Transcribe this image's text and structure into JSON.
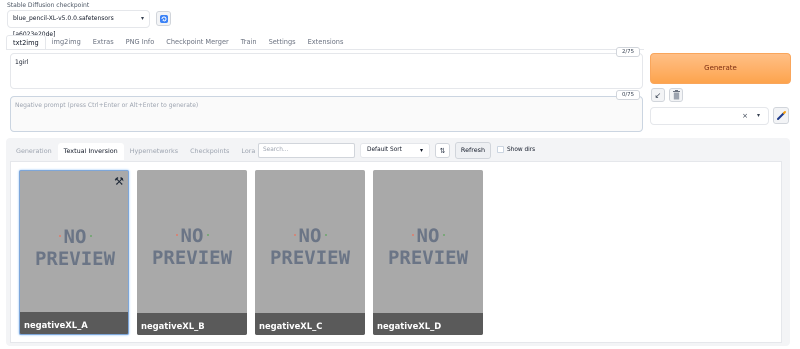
{
  "checkpoint": {
    "label": "Stable Diffusion checkpoint",
    "selected": "blue_pencil-XL-v5.0.0.safetensors [a6023e20de]"
  },
  "tabs": [
    "txt2img",
    "img2img",
    "Extras",
    "PNG Info",
    "Checkpoint Merger",
    "Train",
    "Settings",
    "Extensions"
  ],
  "prompt": {
    "positive_value": "1girl",
    "positive_counter": "2/75",
    "negative_placeholder": "Negative prompt (press Ctrl+Enter or Alt+Enter to generate)",
    "negative_counter": "0/75"
  },
  "generate_label": "Generate",
  "extra_networks": {
    "tabs": [
      "Generation",
      "Textual Inversion",
      "Hypernetworks",
      "Checkpoints",
      "Lora"
    ],
    "search_placeholder": "Search...",
    "sort": "Default Sort",
    "refresh_label": "Refresh",
    "show_dirs_label": "Show dirs",
    "cards": [
      {
        "name": "negativeXL_A",
        "preview": "NO PREVIEW"
      },
      {
        "name": "negativeXL_B",
        "preview": "NO PREVIEW"
      },
      {
        "name": "negativeXL_C",
        "preview": "NO PREVIEW"
      },
      {
        "name": "negativeXL_D",
        "preview": "NO PREVIEW"
      }
    ]
  },
  "colors": {
    "generate_bg": "#fda44d",
    "card_bg": "#a9a9a9",
    "card_name_band": "#5a5a5a"
  }
}
